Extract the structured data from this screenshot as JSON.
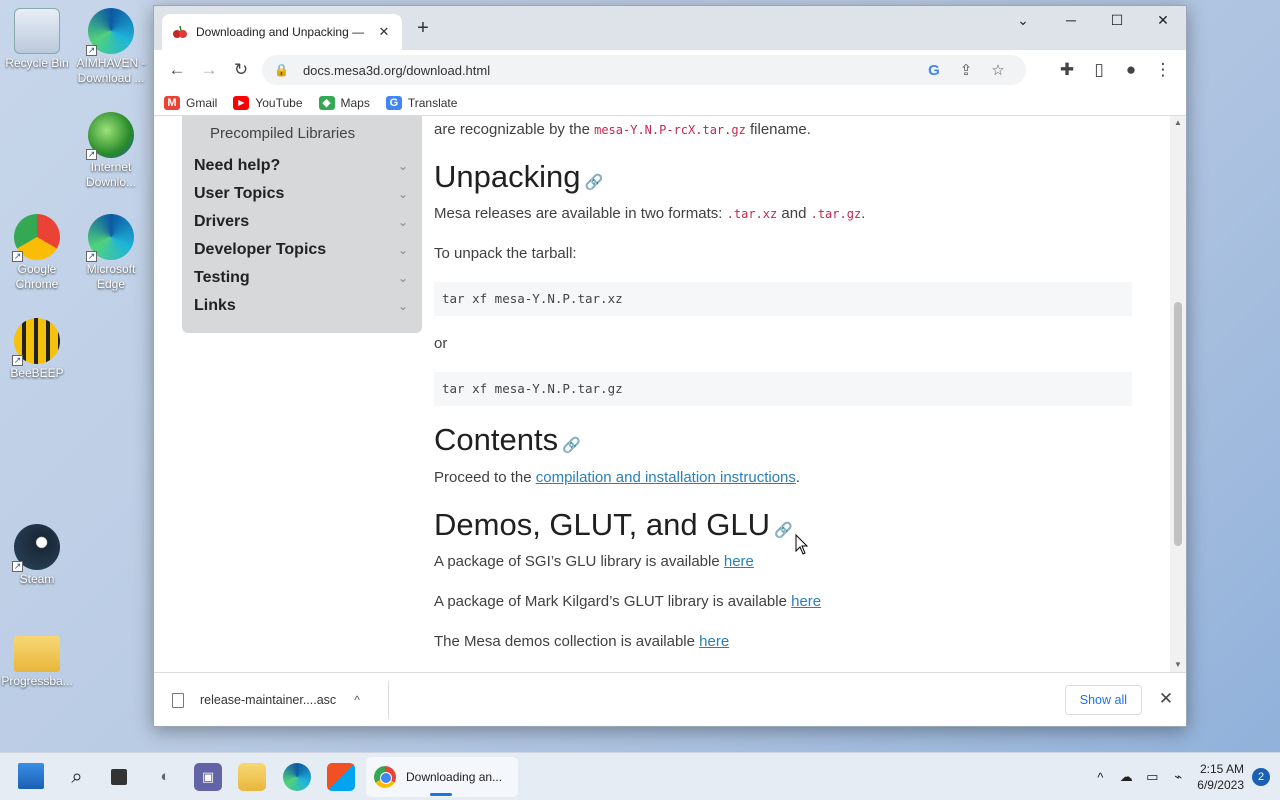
{
  "desktop": {
    "icons": [
      {
        "label": "Recycle Bin",
        "name": "recycle-bin"
      },
      {
        "label": "AIMHAVEN - Download ...",
        "name": "aimhaven"
      },
      {
        "label": "Internet Downlo...",
        "name": "internet-download-manager"
      },
      {
        "label": "Google Chrome",
        "name": "google-chrome"
      },
      {
        "label": "Microsoft Edge",
        "name": "microsoft-edge"
      },
      {
        "label": "BeeBEEP",
        "name": "beebeep"
      },
      {
        "label": "Steam",
        "name": "steam"
      },
      {
        "label": "Progressba...",
        "name": "progressbar-folder"
      }
    ]
  },
  "browser": {
    "tab": {
      "title": "Downloading and Unpacking —",
      "close": "✕"
    },
    "new_tab": "+",
    "window_controls": {
      "dropdown": "⌄",
      "minimize": "─",
      "maximize": "☐",
      "close": "✕"
    },
    "address": {
      "url": "docs.mesa3d.org/download.html"
    },
    "bookmarks": [
      {
        "label": "Gmail",
        "color": "#ea4335",
        "glyph": "M"
      },
      {
        "label": "YouTube",
        "color": "#ff0000",
        "glyph": "▶"
      },
      {
        "label": "Maps",
        "color": "#34a853",
        "glyph": "◆"
      },
      {
        "label": "Translate",
        "color": "#4285f4",
        "glyph": "G"
      }
    ]
  },
  "sidenav": {
    "subitem": "Precompiled Libraries",
    "items": [
      {
        "label": "Need help?"
      },
      {
        "label": "User Topics"
      },
      {
        "label": "Drivers"
      },
      {
        "label": "Developer Topics"
      },
      {
        "label": "Testing"
      },
      {
        "label": "Links"
      }
    ]
  },
  "content": {
    "intro_pre": "are recognizable by the ",
    "intro_code": "mesa-Y.N.P-rcX.tar.gz",
    "intro_post": " filename.",
    "unpacking": {
      "heading": "Unpacking",
      "formats_pre": "Mesa releases are available in two formats: ",
      "format1": ".tar.xz",
      "formats_and": " and ",
      "format2": ".tar.gz",
      "formats_post": ".",
      "instruction": "To unpack the tarball:",
      "cmd1": "tar xf mesa-Y.N.P.tar.xz",
      "or": "or",
      "cmd2": "tar xf mesa-Y.N.P.tar.gz"
    },
    "contents": {
      "heading": "Contents",
      "text_pre": "Proceed to the ",
      "link": "compilation and installation instructions",
      "text_post": "."
    },
    "demos": {
      "heading": "Demos, GLUT, and GLU",
      "line1_pre": "A package of SGI’s GLU library is available ",
      "line2_pre": "A package of Mark Kilgard’s GLUT library is available ",
      "line3_pre": "The Mesa demos collection is available ",
      "link": "here"
    },
    "anchor_icon": "🔗"
  },
  "download_bar": {
    "filename": "release-maintainer....asc",
    "caret": "^",
    "show_all": "Show all",
    "close": "✕"
  },
  "taskbar": {
    "active_app": "Downloading an...",
    "time": "2:15 AM",
    "date": "6/9/2023",
    "notifications": "2"
  }
}
